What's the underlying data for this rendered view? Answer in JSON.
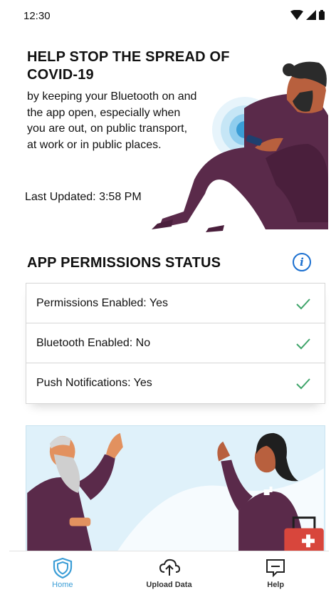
{
  "status_bar": {
    "time": "12:30"
  },
  "hero": {
    "title": "HELP STOP THE SPREAD OF COVID-19",
    "body": "by keeping your Bluetooth on and the app open, especially when you are out, on public transport, at work or in public places.",
    "last_updated": "Last Updated:  3:58 PM"
  },
  "permissions": {
    "title": "APP PERMISSIONS STATUS",
    "rows": [
      {
        "label": "Permissions Enabled: Yes"
      },
      {
        "label": "Bluetooth Enabled: No"
      },
      {
        "label": "Push Notifications: Yes"
      }
    ]
  },
  "nav": {
    "home": "Home",
    "upload": "Upload Data",
    "help": "Help"
  },
  "colors": {
    "accent": "#3a9dd6",
    "check": "#3fa46a",
    "info": "#1a6fd0",
    "figure_purple": "#5a2a4a"
  },
  "icons": [
    "wifi-icon",
    "signal-icon",
    "battery-icon",
    "info-icon",
    "check-icon",
    "shield-icon",
    "upload-cloud-icon",
    "help-message-icon"
  ]
}
